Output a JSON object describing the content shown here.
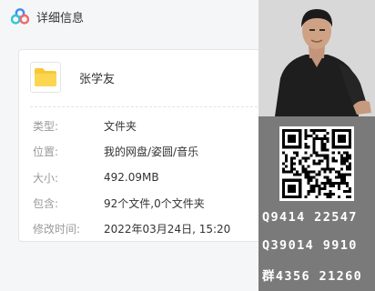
{
  "window": {
    "title": "详细信息",
    "file_name": "张学友",
    "details": [
      {
        "label": "类型:",
        "value": "文件夹"
      },
      {
        "label": "位置:",
        "value": "我的网盘/姿圆/音乐"
      },
      {
        "label": "大小:",
        "value": "492.09MB"
      },
      {
        "label": "包含:",
        "value": "92个文件,0个文件夹"
      },
      {
        "label": "修改时间:",
        "value": "2022年03月24日, 15:20"
      }
    ]
  },
  "promo": {
    "contacts": [
      "Q9414 22547",
      "Q39014 9910",
      "群4356 21260"
    ]
  },
  "colors": {
    "folder_yellow": "#f8c835",
    "brand_blue": "#3f8cf2",
    "promo_gray": "#7a7a7a"
  },
  "icons": [
    "cloud-logo-icon",
    "folder-icon",
    "qr-code-icon"
  ]
}
